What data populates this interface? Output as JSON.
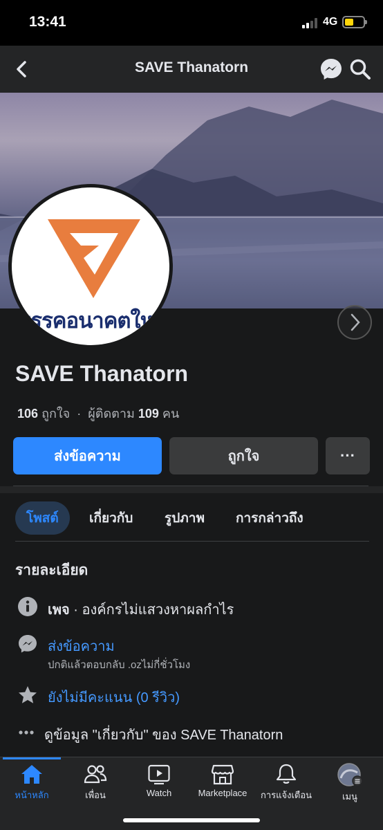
{
  "status_bar": {
    "time": "13:41",
    "network": "4G",
    "battery_level": 0.35
  },
  "topbar": {
    "title": "SAVE Thanatorn",
    "icons": [
      "back-icon",
      "messenger-icon",
      "search-icon"
    ]
  },
  "profile": {
    "logo_text": "พรรคอนาคตใหม่",
    "logo_color": "#e87d3e",
    "name": "SAVE Thanatorn",
    "likes_count": "106",
    "likes_label": "ถูกใจ",
    "separator": "·",
    "followers_label": "ผู้ติดตาม",
    "followers_count": "109",
    "followers_unit": "คน"
  },
  "actions": {
    "message": "ส่งข้อความ",
    "like": "ถูกใจ",
    "more": "···"
  },
  "tabs": [
    {
      "label": "โพสต์",
      "active": true
    },
    {
      "label": "เกี่ยวกับ",
      "active": false
    },
    {
      "label": "รูปภาพ",
      "active": false
    },
    {
      "label": "การกล่าวถึง",
      "active": false
    }
  ],
  "details": {
    "title": "รายละเอียด",
    "page_type_bold": "เพจ",
    "page_type_rest": " · องค์กรไม่แสวงหาผลกำไร",
    "message_link": "ส่งข้อความ",
    "response_time": "ปกติแล้วตอบกลับ .ozไม่กี่ชั่วโมง",
    "rating": "ยังไม่มีคะแนน (0 รีวิว)",
    "about_link": "ดูข้อมูล \"เกี่ยวกับ\" ของ SAVE Thanatorn"
  },
  "bottom_nav": [
    {
      "label": "หน้าหลัก",
      "icon": "home-icon",
      "active": true
    },
    {
      "label": "เพื่อน",
      "icon": "friends-icon",
      "active": false
    },
    {
      "label": "Watch",
      "icon": "watch-icon",
      "active": false
    },
    {
      "label": "Marketplace",
      "icon": "marketplace-icon",
      "active": false
    },
    {
      "label": "การแจ้งเตือน",
      "icon": "bell-icon",
      "active": false
    },
    {
      "label": "เมนู",
      "icon": "menu-avatar-icon",
      "active": false
    }
  ],
  "colors": {
    "accent": "#2d88ff",
    "background": "#18191a",
    "surface": "#242526",
    "button": "#3a3b3c"
  }
}
